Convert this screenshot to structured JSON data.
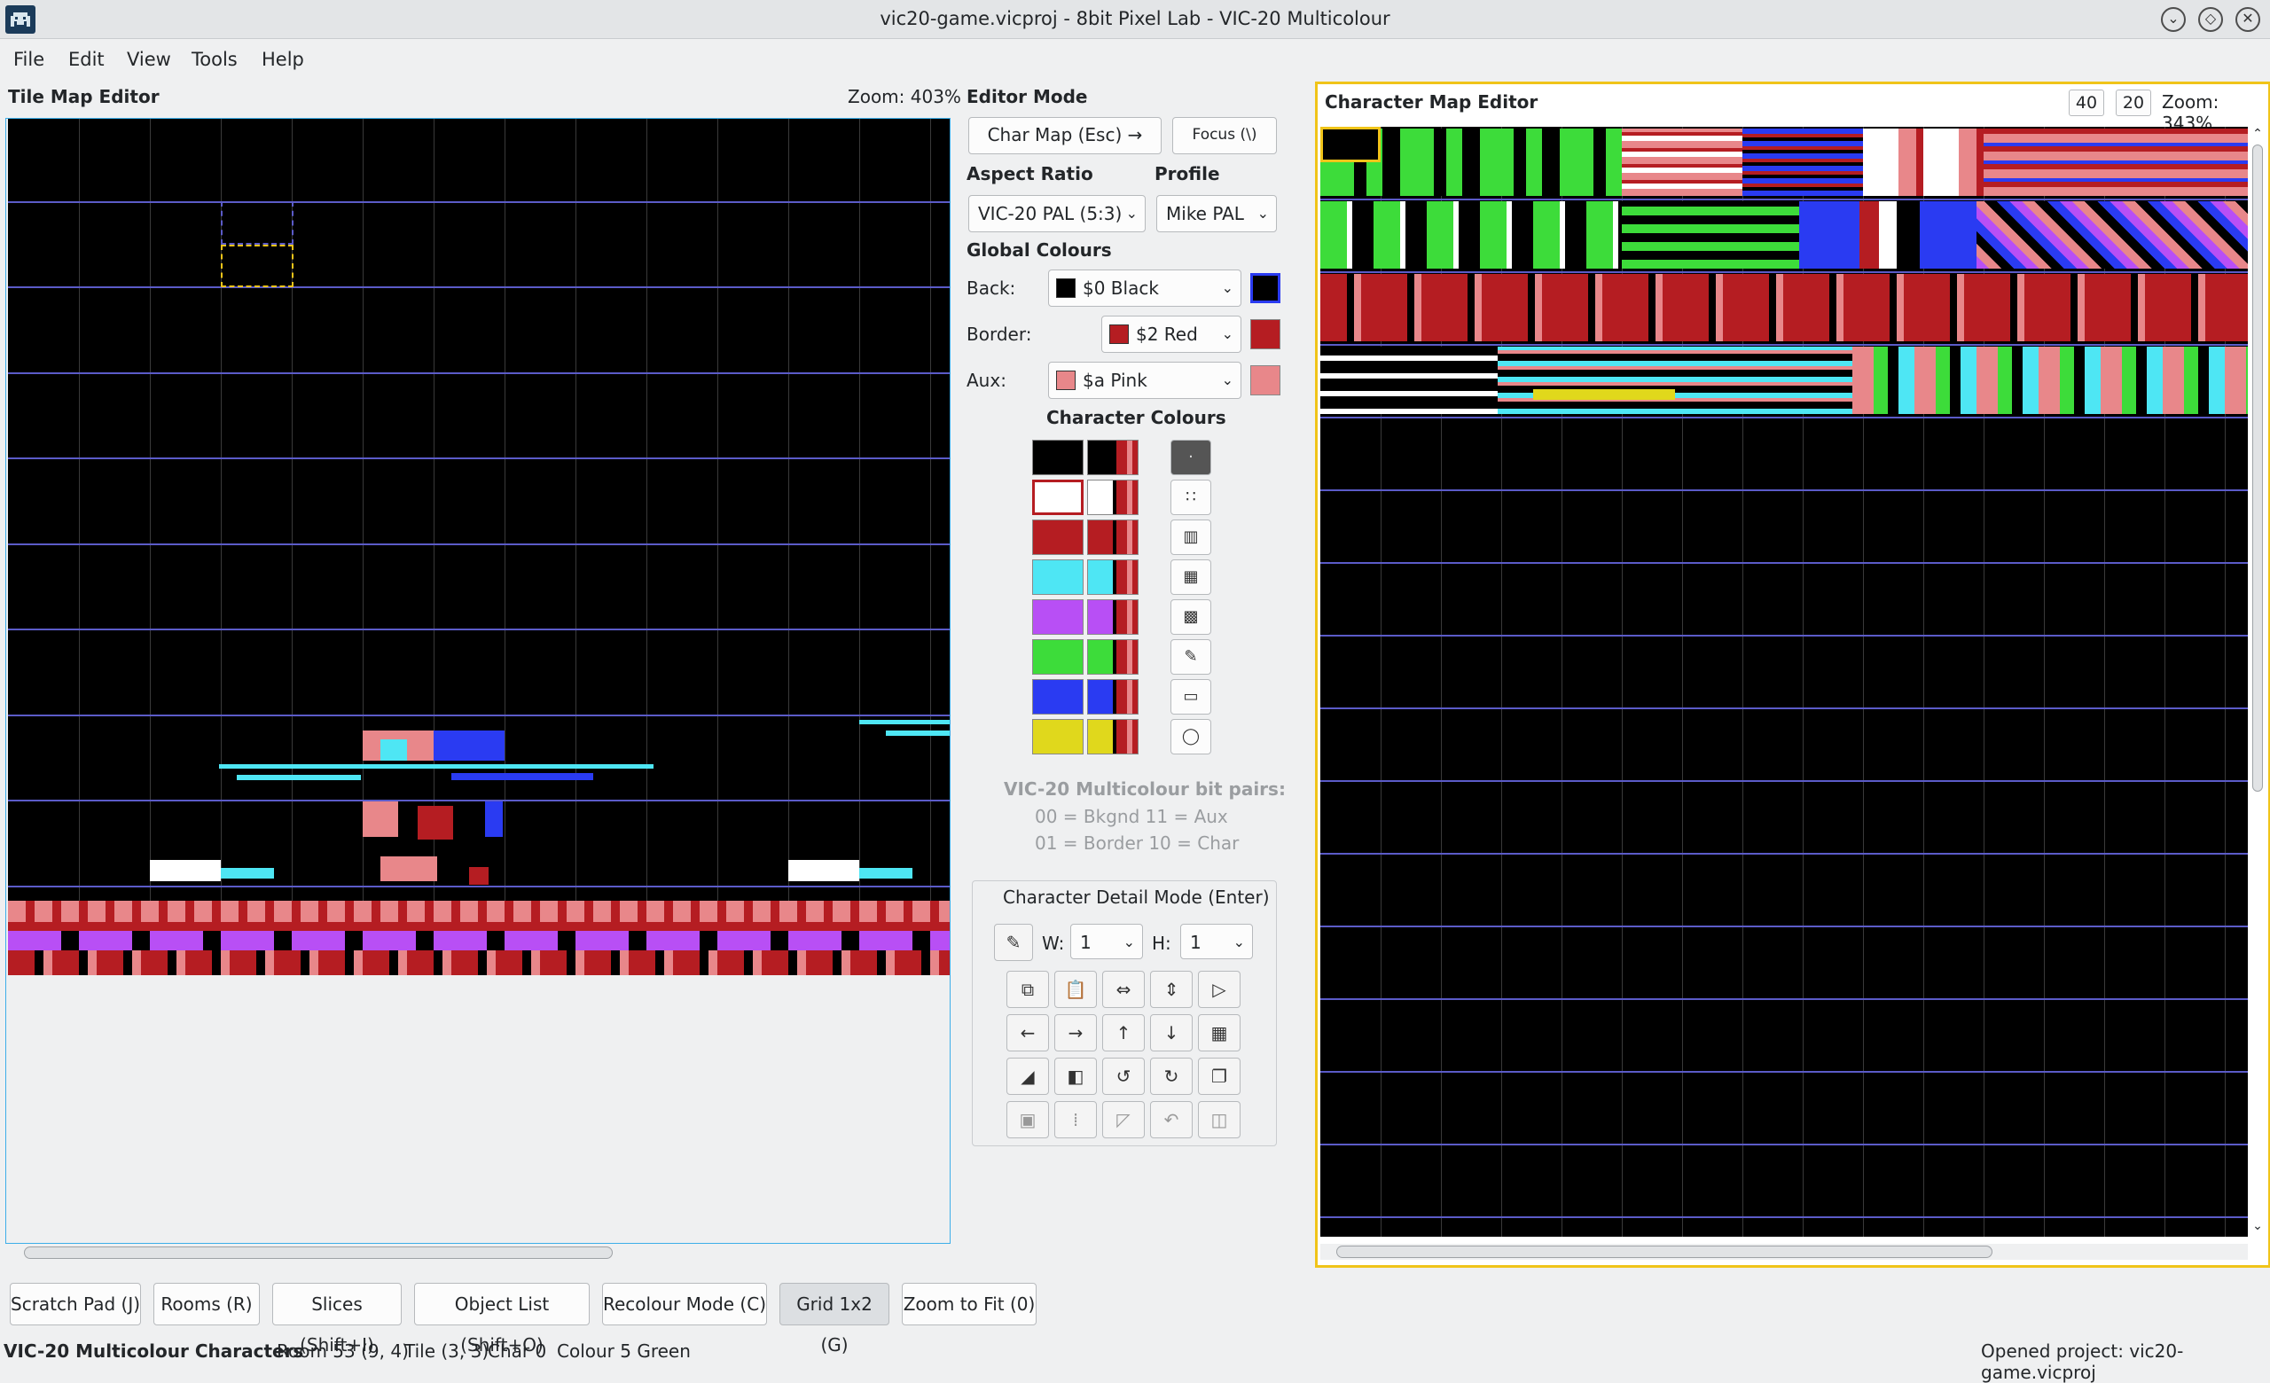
{
  "window": {
    "title": "vic20-game.vicproj - 8bit Pixel Lab - VIC-20 Multicolour",
    "app_icon": "space-invader-icon"
  },
  "menu": [
    "File",
    "Edit",
    "View",
    "Tools",
    "Help"
  ],
  "tile_map": {
    "title": "Tile Map Editor",
    "zoom": "Zoom: 403%"
  },
  "editor": {
    "mode_title": "Editor Mode",
    "char_map_button": "Char Map (Esc) →",
    "focus_button": "Focus (\\)",
    "aspect_label": "Aspect Ratio",
    "aspect_value": "VIC-20 PAL (5:3)",
    "profile_label": "Profile",
    "profile_value": "Mike PAL",
    "global_colours_title": "Global Colours",
    "back_label": "Back:",
    "back_value": "$0 Black",
    "border_label": "Border:",
    "border_value": "$2 Red",
    "aux_label": "Aux:",
    "aux_value": "$a Pink",
    "char_colours_title": "Character Colours",
    "bitpairs_title": "VIC-20 Multicolour bit pairs:",
    "bitpairs_line1": "00 = Bkgnd  11 = Aux",
    "bitpairs_line2": "01 = Border 10 = Char",
    "detail_title": "Character Detail Mode (Enter)",
    "w_label": "W:",
    "w_value": "1",
    "h_label": "H:",
    "h_value": "1"
  },
  "colors": {
    "black": "#000000",
    "red": "#b51d22",
    "pink": "#e8878a",
    "white": "#ffffff",
    "cyan": "#4ee6f4",
    "purple": "#b84ff5",
    "green": "#3ddc3a",
    "blue": "#2a3bf2",
    "yellow": "#e0d81c",
    "grid_line": "#5b5bc8",
    "selection": "#f0c419"
  },
  "char_colour_rows": [
    "black",
    "white",
    "red",
    "cyan",
    "purple",
    "green",
    "blue",
    "yellow"
  ],
  "char_map": {
    "title": "Character Map Editor",
    "cols": "40",
    "rows": "20",
    "zoom": "Zoom: 343%"
  },
  "bottom_buttons": [
    "Scratch Pad (J)",
    "Rooms (R)",
    "Slices (Shift+I)",
    "Object List (Shift+O)",
    "Recolour Mode (C)",
    "Grid 1x2 (G)",
    "Zoom to Fit (0)"
  ],
  "status": {
    "mode": "VIC-20 Multicolour Characters",
    "room": "Room 53 (9, 4)",
    "tile": "Tile (3, 3)",
    "char": "Char 0",
    "colour": "Colour 5 Green",
    "message": "Opened project: vic20-game.vicproj"
  }
}
